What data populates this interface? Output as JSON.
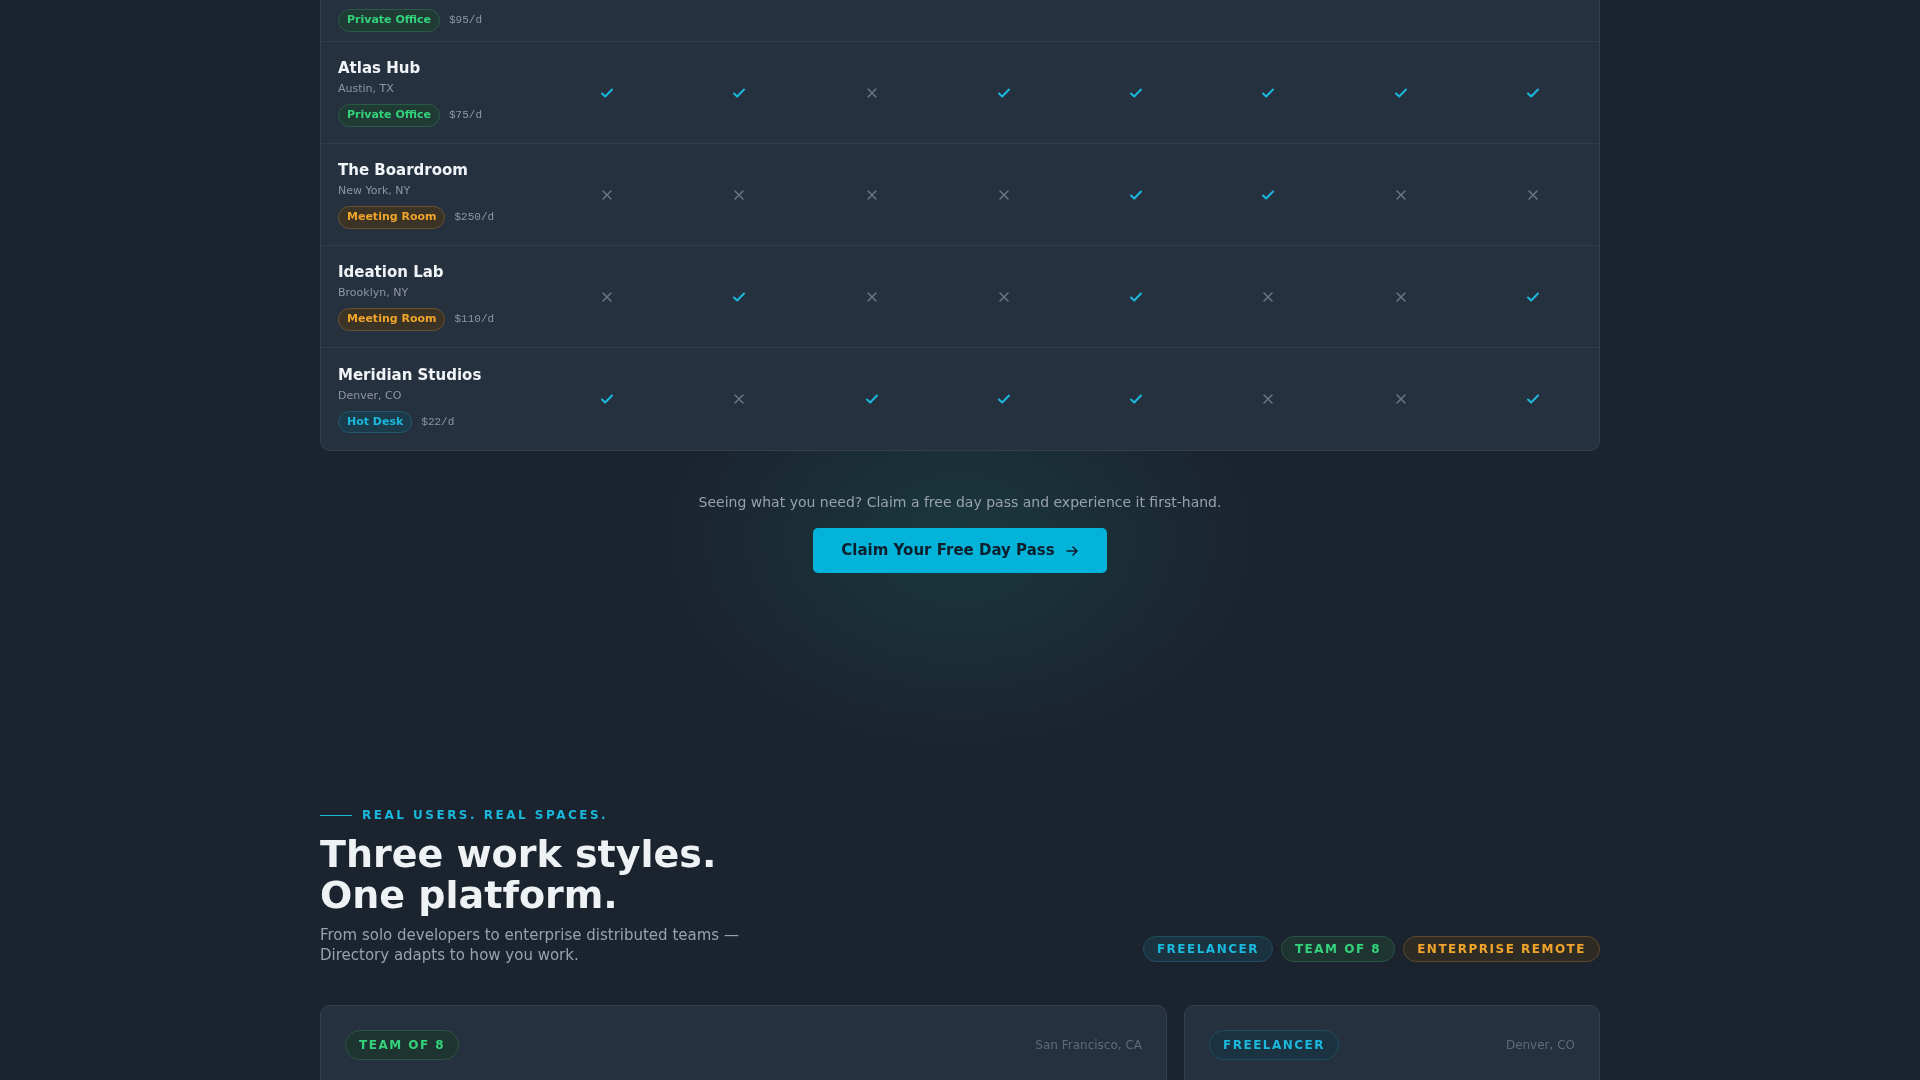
{
  "comparison": {
    "rows": [
      {
        "badge": {
          "label": "Private Office",
          "kind": "office"
        },
        "price": "$95/d"
      },
      {
        "name": "Atlas Hub",
        "location": "Austin, TX",
        "badge": {
          "label": "Private Office",
          "kind": "office"
        },
        "price": "$75/d",
        "features": [
          true,
          true,
          false,
          true,
          true,
          true,
          true,
          true
        ]
      },
      {
        "name": "The Boardroom",
        "location": "New York, NY",
        "badge": {
          "label": "Meeting Room",
          "kind": "meeting"
        },
        "price": "$250/d",
        "features": [
          false,
          false,
          false,
          false,
          true,
          true,
          false,
          false
        ]
      },
      {
        "name": "Ideation Lab",
        "location": "Brooklyn, NY",
        "badge": {
          "label": "Meeting Room",
          "kind": "meeting"
        },
        "price": "$110/d",
        "features": [
          false,
          true,
          false,
          false,
          true,
          false,
          false,
          true
        ]
      },
      {
        "name": "Meridian Studios",
        "location": "Denver, CO",
        "badge": {
          "label": "Hot Desk",
          "kind": "desk"
        },
        "price": "$22/d",
        "features": [
          true,
          false,
          true,
          true,
          true,
          false,
          false,
          true
        ]
      }
    ]
  },
  "cta": {
    "text": "Seeing what you need? Claim a free day pass and experience it first-hand.",
    "button": "Claim Your Free Day Pass"
  },
  "stories": {
    "eyebrow": "REAL USERS. REAL SPACES.",
    "heading": [
      "Three work styles.",
      "One platform."
    ],
    "description": "From solo developers to enterprise distributed teams — Directory adapts to how you work.",
    "filters": [
      {
        "label": "FREELANCER",
        "kind": "freelancer"
      },
      {
        "label": "TEAM OF 8",
        "kind": "team"
      },
      {
        "label": "ENTERPRISE REMOTE",
        "kind": "enterprise"
      }
    ],
    "cards": [
      {
        "tag": {
          "label": "TEAM OF 8",
          "kind": "team"
        },
        "location": "San Francisco, CA"
      },
      {
        "tag": {
          "label": "FREELANCER",
          "kind": "freelancer"
        },
        "location": "Denver, CO"
      }
    ]
  }
}
